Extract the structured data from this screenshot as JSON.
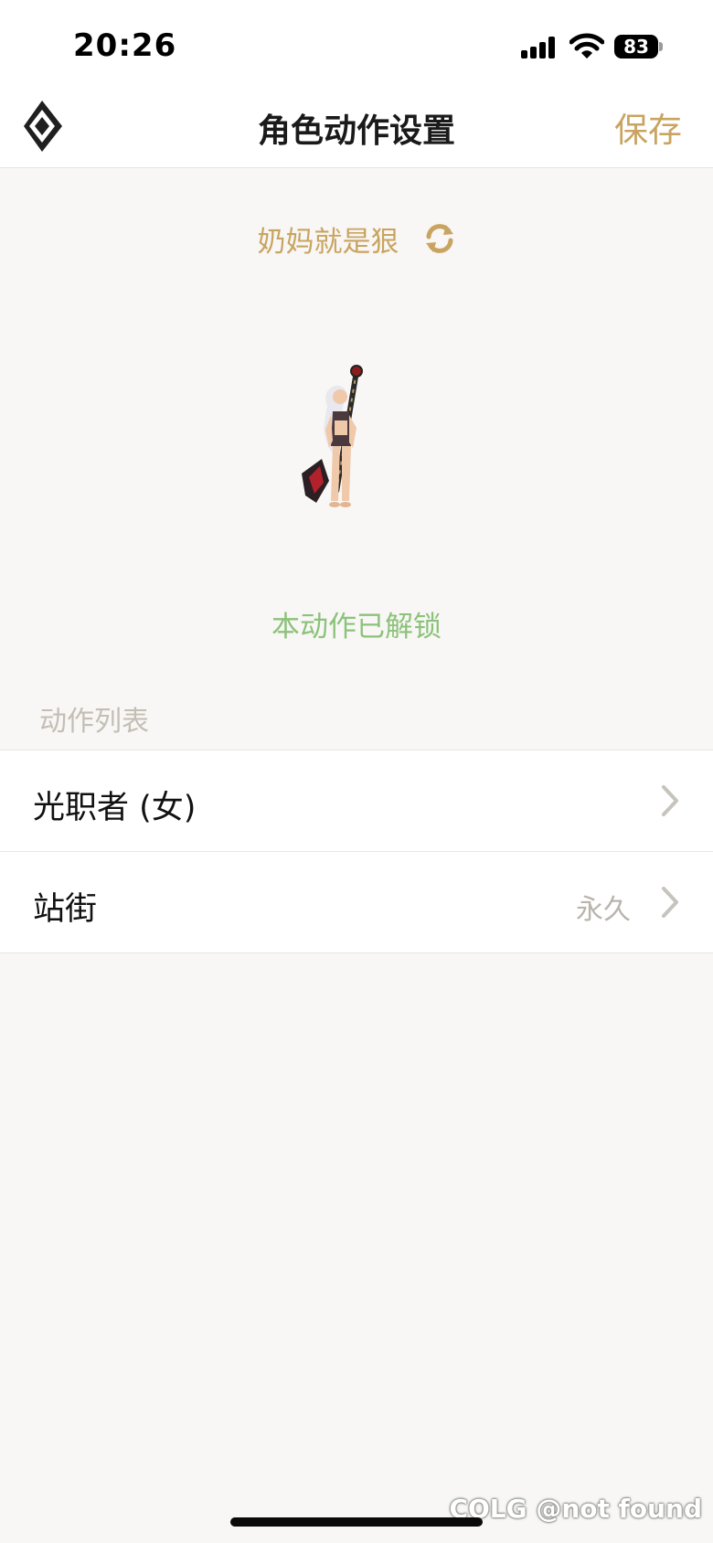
{
  "status_bar": {
    "time": "20:26",
    "battery_level": "83"
  },
  "nav": {
    "title": "角色动作设置",
    "save_label": "保存",
    "logo_icon": "diamond-logo-icon"
  },
  "character": {
    "name": "奶妈就是狠",
    "refresh_icon": "refresh-icon",
    "unlock_status": "本动作已解锁"
  },
  "section": {
    "label": "动作列表"
  },
  "list": {
    "items": [
      {
        "label": "光职者 (女)",
        "value": ""
      },
      {
        "label": "站街",
        "value": "永久"
      }
    ]
  },
  "watermark": {
    "text": "COLG @not found"
  },
  "colors": {
    "accent_gold": "#c9a461",
    "unlock_green": "#8cc27a",
    "background": "#f8f7f5"
  }
}
